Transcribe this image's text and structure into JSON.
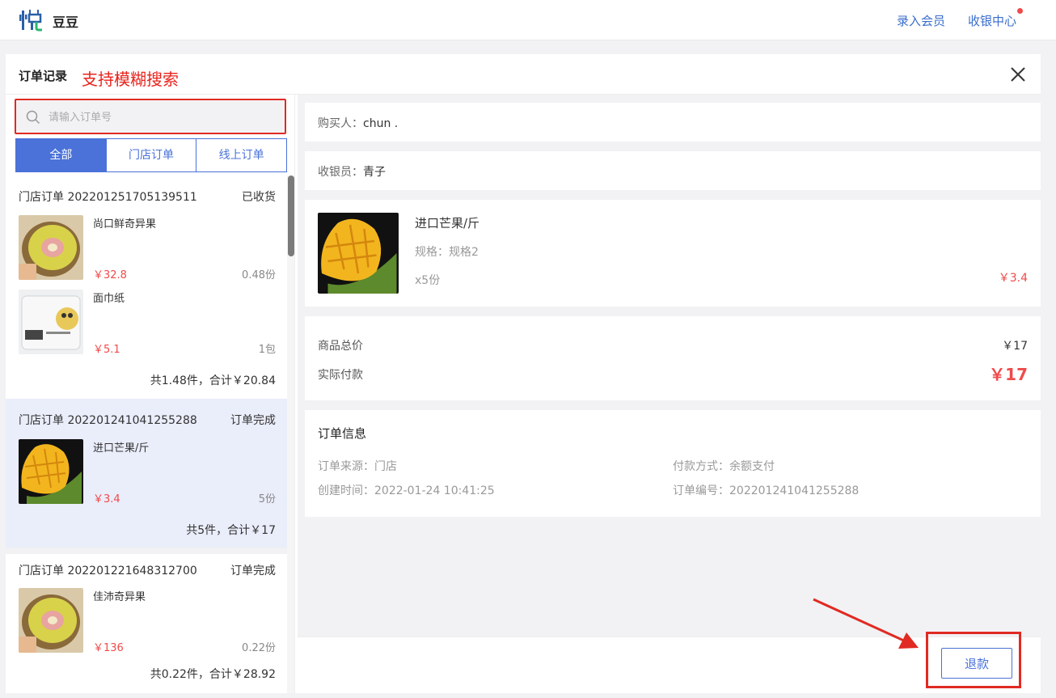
{
  "app": {
    "store_name": "豆豆",
    "nav": {
      "add_member": "录入会员",
      "cashier_center": "收银中心"
    }
  },
  "panel": {
    "title": "订单记录",
    "annotation": "支持模糊搜索",
    "search": {
      "placeholder": "请输入订单号",
      "value": ""
    },
    "tabs": [
      {
        "label": "全部",
        "active": true
      },
      {
        "label": "门店订单",
        "active": false
      },
      {
        "label": "线上订单",
        "active": false
      }
    ],
    "orders": [
      {
        "number": "门店订单 202201251705139511",
        "status": "已收货",
        "items": [
          {
            "name": "尚口鲜奇异果",
            "price": "￥32.8",
            "qty": "0.48份",
            "image": "kiwi"
          },
          {
            "name": "面巾纸",
            "price": "￥5.1",
            "qty": "1包",
            "image": "tissue"
          }
        ],
        "summary": "共1.48件，合计￥20.84"
      },
      {
        "number": "门店订单 202201241041255288",
        "status": "订单完成",
        "selected": true,
        "items": [
          {
            "name": "进口芒果/斤",
            "price": "￥3.4",
            "qty": "5份",
            "image": "mango"
          }
        ],
        "summary": "共5件，合计￥17"
      },
      {
        "number": "门店订单 202201221648312700",
        "status": "订单完成",
        "items": [
          {
            "name": "佳沛奇异果",
            "price": "￥136",
            "qty": "0.22份",
            "image": "kiwi"
          }
        ],
        "summary": "共0.22件，合计￥28.92"
      }
    ]
  },
  "detail": {
    "buyer": {
      "label": "购买人：",
      "value": "chun ."
    },
    "cashier": {
      "label": "收银员：",
      "value": "青子"
    },
    "product": {
      "name": "进口芒果/斤",
      "spec": "规格：规格2",
      "qty": "x5份",
      "price": "￥3.4",
      "image": "mango"
    },
    "totals": {
      "goods_label": "商品总价",
      "goods_value": "￥17",
      "paid_label": "实际付款",
      "paid_value": "￥17"
    },
    "info": {
      "title": "订单信息",
      "source": "订单来源：门店",
      "created": "创建时间：2022-01-24 10:41:25",
      "payment": "付款方式：余额支付",
      "order_no": "订单编号：202201241041255288"
    },
    "refund_label": "退款"
  },
  "colors": {
    "accent": "#4a72d8",
    "price": "#f04a4a",
    "annotation": "#e02a22"
  }
}
